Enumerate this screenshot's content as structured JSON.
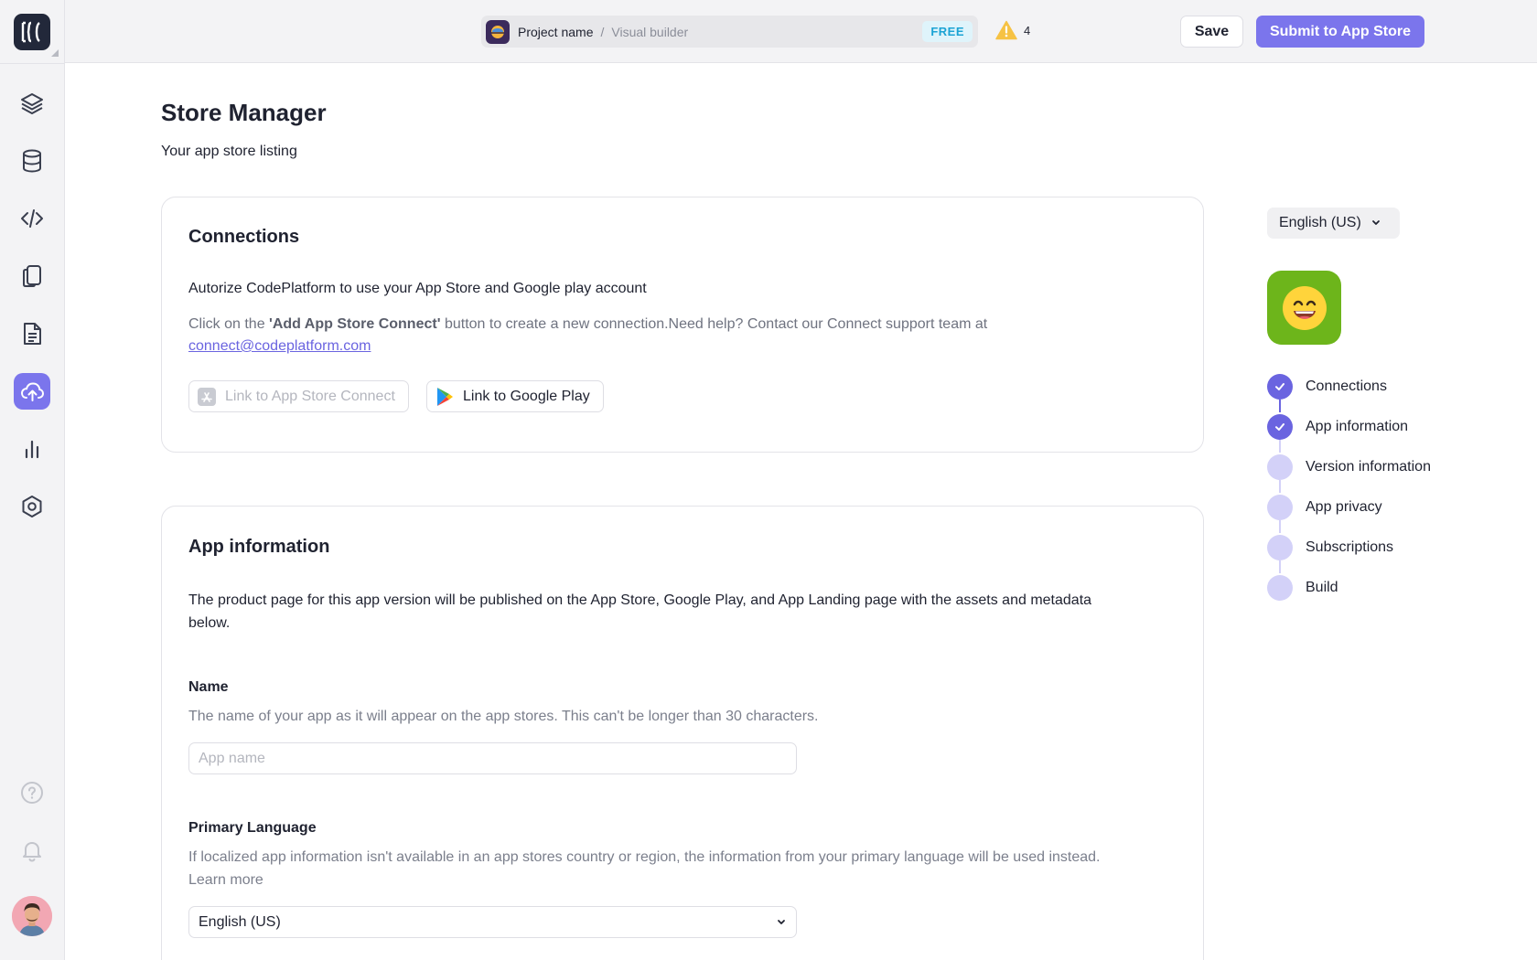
{
  "topbar": {
    "project_name": "Project name",
    "separator": "/",
    "section": "Visual builder",
    "plan_badge": "FREE",
    "warning_count": "4",
    "save_label": "Save",
    "submit_label": "Submit to App Store"
  },
  "sidebar": {
    "logo_text": "[{(",
    "items": [
      {
        "icon": "layers-icon",
        "active": false
      },
      {
        "icon": "database-icon",
        "active": false
      },
      {
        "icon": "code-icon",
        "active": false
      },
      {
        "icon": "devices-icon",
        "active": false
      },
      {
        "icon": "document-icon",
        "active": false
      },
      {
        "icon": "cloud-upload-icon",
        "active": true
      },
      {
        "icon": "analytics-icon",
        "active": false
      },
      {
        "icon": "settings-icon",
        "active": false
      }
    ],
    "bottom": [
      "help-icon",
      "bell-icon",
      "avatar"
    ]
  },
  "main": {
    "title": "Store Manager",
    "subtitle": "Your app store listing"
  },
  "connections": {
    "title": "Connections",
    "text": "Autorize CodePlatform to use your App Store and Google play account",
    "help_prefix": "Click on the ",
    "help_bold": "'Add App Store Connect'",
    "help_suffix": " button to create a new connection.Need help? Contact our Connect support team at",
    "support_email": "connect@codeplatform.com",
    "appstore_button": "Link to App Store Connect",
    "gplay_button": "Link to Google Play"
  },
  "app_info": {
    "title": "App information",
    "description": "The product page for this app version will be published on the App Store, Google Play, and App Landing page with the assets and metadata below.",
    "name_label": "Name",
    "name_help": "The name of your app as it will appear on the app stores. This can't be longer than 30 characters.",
    "name_placeholder": "App name",
    "lang_label": "Primary Language",
    "lang_help": "If localized app information isn't available in an app stores country or region, the information from your primary language will be used instead.",
    "learn_more": "Learn more",
    "lang_value": "English (US)"
  },
  "right_panel": {
    "language": "English (US)",
    "app_icon": "smiling-emoji-icon",
    "steps": [
      {
        "label": "Connections",
        "done": true
      },
      {
        "label": "App information",
        "done": true
      },
      {
        "label": "Version information",
        "done": false
      },
      {
        "label": "App privacy",
        "done": false
      },
      {
        "label": "Subscriptions",
        "done": false
      },
      {
        "label": "Build",
        "done": false
      }
    ]
  },
  "colors": {
    "accent": "#7b75ec",
    "accent_dark": "#6a64e0",
    "step_pending": "#d3d1f8",
    "app_icon_bg": "#6db51b",
    "free_badge": "#1ba3d4"
  }
}
